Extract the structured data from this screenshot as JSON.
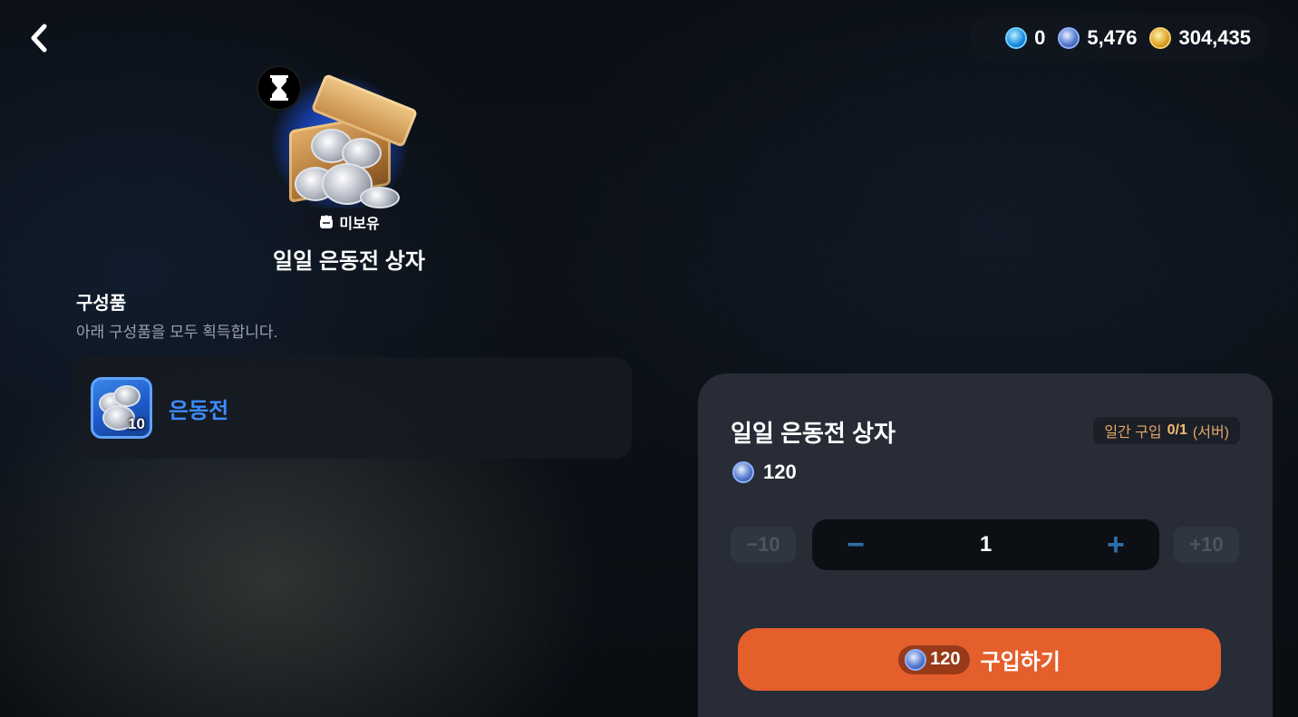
{
  "header": {
    "back_icon": "chevron-left-icon",
    "currencies": [
      {
        "icon": "blue-gem-icon",
        "value": "0"
      },
      {
        "icon": "silver-coin-icon",
        "value": "5,476"
      },
      {
        "icon": "gold-coin-icon",
        "value": "304,435"
      }
    ]
  },
  "item": {
    "timer_icon": "hourglass-icon",
    "ownership_icon": "fist-icon",
    "ownership_label": "미보유",
    "title": "일일 은동전 상자"
  },
  "components": {
    "title": "구성품",
    "description": "아래 구성품을 모두 획득합니다.",
    "items": [
      {
        "icon": "silver-coins-icon",
        "count": "10",
        "name": "은동전"
      }
    ]
  },
  "purchase": {
    "title": "일일 은동전 상자",
    "limit_label": "일간 구입",
    "limit_count": "0/1",
    "limit_scope": "(서버)",
    "price": "120",
    "qty_minus10": "−10",
    "qty_plus10": "+10",
    "qty_minus": "−",
    "qty_plus": "+",
    "quantity": "1",
    "buy_price": "120",
    "buy_label": "구입하기"
  },
  "colors": {
    "accent_orange": "#e45f2c",
    "accent_blue": "#3b8cff",
    "panel": "#272c36"
  }
}
